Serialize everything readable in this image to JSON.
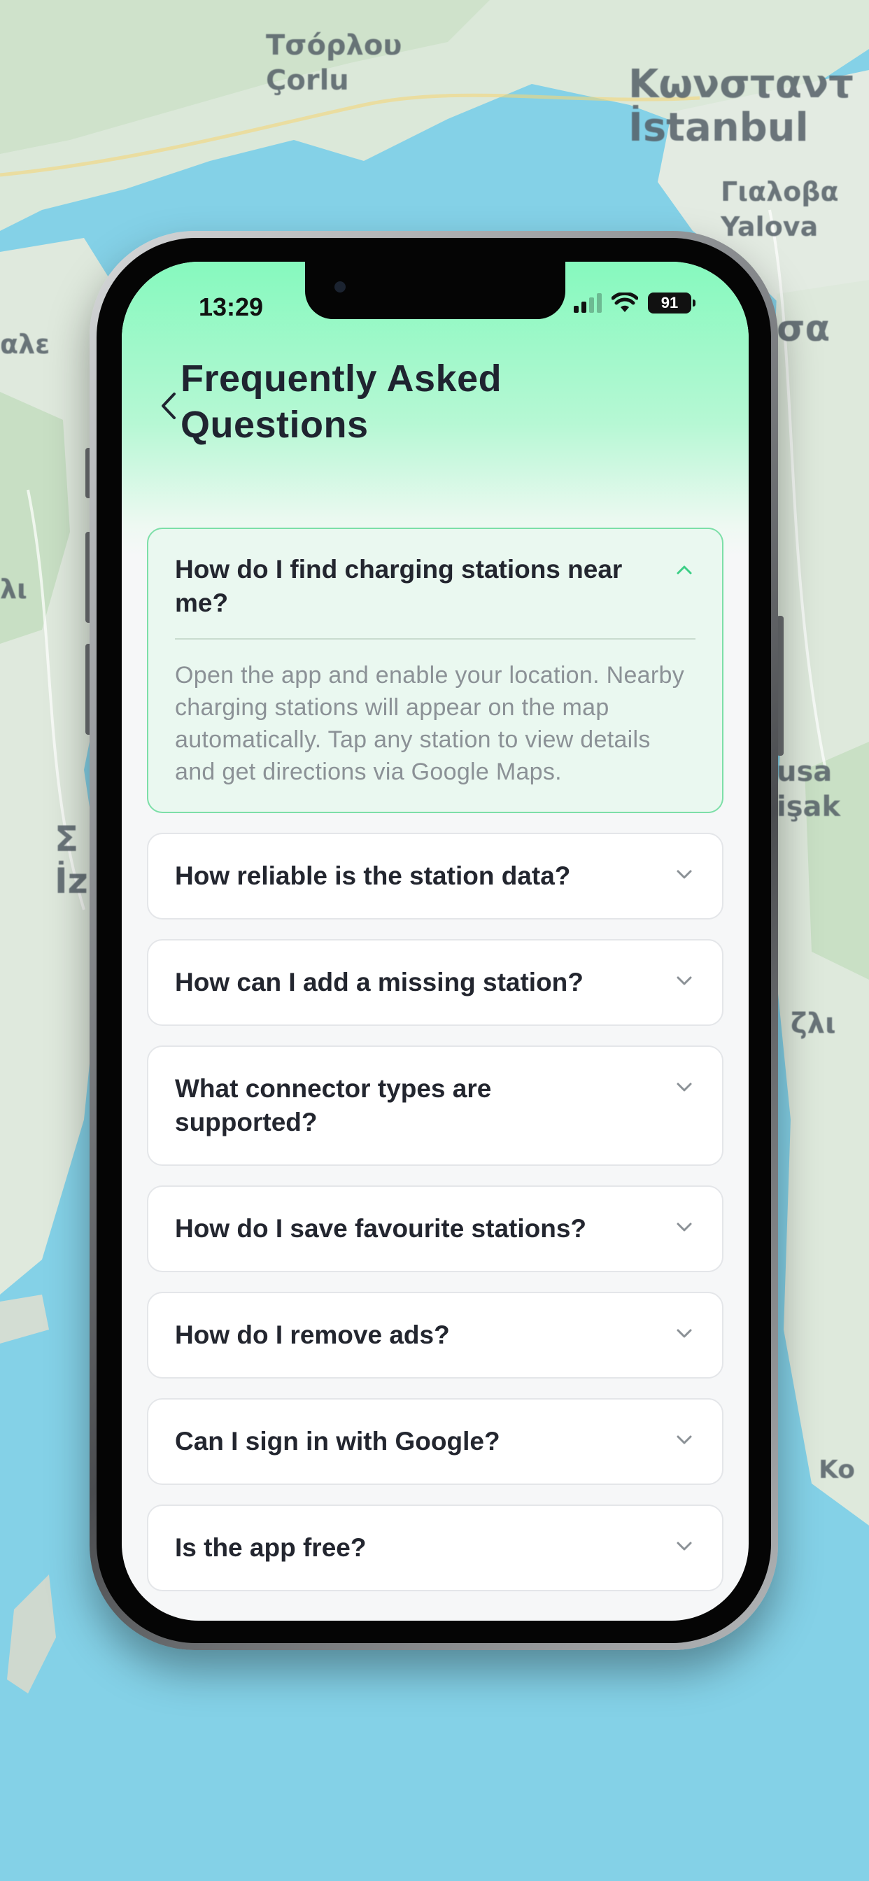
{
  "map": {
    "labels": [
      "Τσόρλου",
      "Çorlu",
      "Κωνσταντ",
      "İstanbul",
      "Γιαλοβα",
      "Yalova",
      "σα",
      "αλε",
      "λι",
      "Σ",
      "İz",
      "usa",
      "işak",
      "ζλι",
      "Ko"
    ]
  },
  "status_bar": {
    "time": "13:29",
    "battery": "91"
  },
  "header": {
    "title": "Frequently Asked Questions"
  },
  "faq": {
    "items": [
      {
        "question": "How do I find charging stations near me?",
        "answer": "Open the app and enable your location. Nearby charging stations will appear on the map automatically. Tap any station to view details and get directions via Google Maps.",
        "expanded": true
      },
      {
        "question": "How reliable is the station data?",
        "expanded": false
      },
      {
        "question": "How can I add a missing station?",
        "expanded": false
      },
      {
        "question": "What connector types are supported?",
        "expanded": false
      },
      {
        "question": "How do I save favourite stations?",
        "expanded": false
      },
      {
        "question": "How do I remove ads?",
        "expanded": false
      },
      {
        "question": "Can I sign in with Google?",
        "expanded": false
      },
      {
        "question": "Is the app free?",
        "expanded": false
      }
    ]
  },
  "colors": {
    "header_gradient_top": "#86f9be",
    "accent_green": "#3ccf86",
    "open_item_bg": "#eaf8f0"
  }
}
